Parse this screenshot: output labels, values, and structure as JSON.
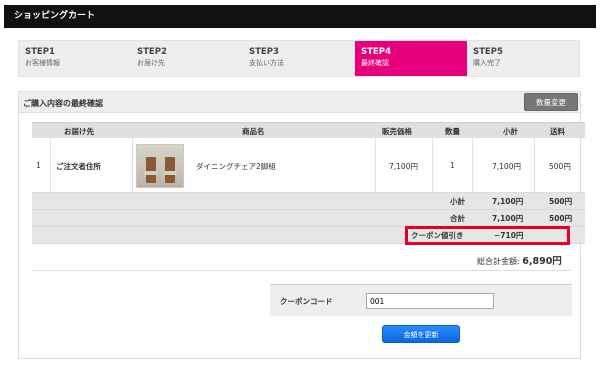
{
  "app": {
    "title": "ショッピングカート"
  },
  "steps": [
    {
      "title": "STEP1",
      "sub": "お客様情報",
      "active": false
    },
    {
      "title": "STEP2",
      "sub": "お届け先",
      "active": false
    },
    {
      "title": "STEP3",
      "sub": "支払い方法",
      "active": false
    },
    {
      "title": "STEP4",
      "sub": "最終確認",
      "active": true
    },
    {
      "title": "STEP5",
      "sub": "購入完了",
      "active": false
    }
  ],
  "panel": {
    "title": "ご購入内容の最終確認",
    "qty_button": "数量変更"
  },
  "table": {
    "headers": {
      "dest": "お届け先",
      "product": "商品名",
      "price": "販売価格",
      "qty": "数量",
      "subtotal": "小計",
      "shipping": "送料"
    },
    "rows": [
      {
        "index": "1",
        "dest": "ご注文者住所",
        "product": "ダイニングチェア2脚組",
        "price": "7,100円",
        "qty": "1",
        "subtotal": "7,100円",
        "shipping": "500円"
      }
    ]
  },
  "summary": {
    "subtotal_label": "小計",
    "subtotal_value": "7,100円",
    "subtotal_ship": "500円",
    "total_label": "合計",
    "total_value": "7,100円",
    "total_ship": "500円",
    "coupon_label": "クーポン値引き",
    "coupon_value": "−710円",
    "grand_label": "総合計金額:",
    "grand_value": "6,890円"
  },
  "coupon": {
    "label": "クーポンコード",
    "value": "001",
    "update_button": "金額を更新"
  },
  "colors": {
    "active_step": "#e6007e",
    "highlight_border": "#e8001c",
    "primary_button": "#1a7cf0"
  }
}
